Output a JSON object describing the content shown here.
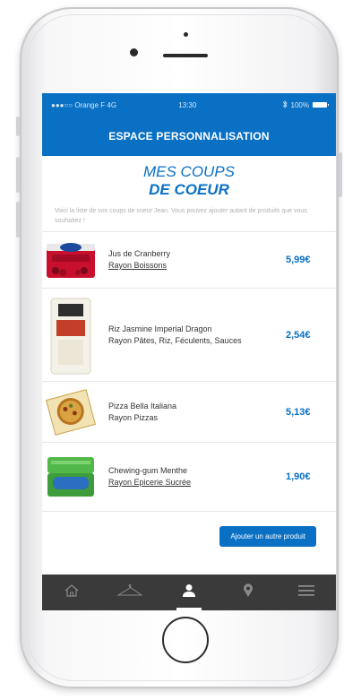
{
  "status_bar": {
    "carrier": "●●●○○ Orange F  4G",
    "time": "13:30",
    "battery": "100%",
    "bluetooth_icon": "bluetooth-icon"
  },
  "header": {
    "title": "ESPACE PERSONNALISATION"
  },
  "page": {
    "title_line1": "MES COUPS",
    "title_line2": "DE COEUR",
    "intro": "Voici la liste de vos coups de coeur Jean. Vous pouvez ajouter autant de produits que vous souhaitez !"
  },
  "products": [
    {
      "name": "Jus de Cranberry",
      "rayon": "Rayon Boissons",
      "price": "5,99€",
      "image_icon": "cranberry-juice-image"
    },
    {
      "name": "Riz Jasmine Imperial Dragon",
      "rayon": "Rayon Pâtes, Riz, Féculents, Sauces",
      "price": "2,54€",
      "image_icon": "rice-bag-image"
    },
    {
      "name": "Pizza Bella Italiana",
      "rayon": "Rayon Pizzas",
      "price": "5,13€",
      "image_icon": "pizza-box-image"
    },
    {
      "name": "Chewing-gum Menthe",
      "rayon": "Rayon Epicerie Sucrée",
      "price": "1,90€",
      "image_icon": "chewing-gum-image"
    }
  ],
  "cta": {
    "label": "Ajouter un autre produit"
  },
  "tabbar": {
    "items": [
      {
        "icon": "home-icon"
      },
      {
        "icon": "hanger-icon"
      },
      {
        "icon": "user-icon",
        "active": true
      },
      {
        "icon": "location-pin-icon"
      },
      {
        "icon": "menu-icon"
      }
    ]
  },
  "colors": {
    "brand_blue": "#0a70c4",
    "tabbar_bg": "#3a3a3a"
  }
}
